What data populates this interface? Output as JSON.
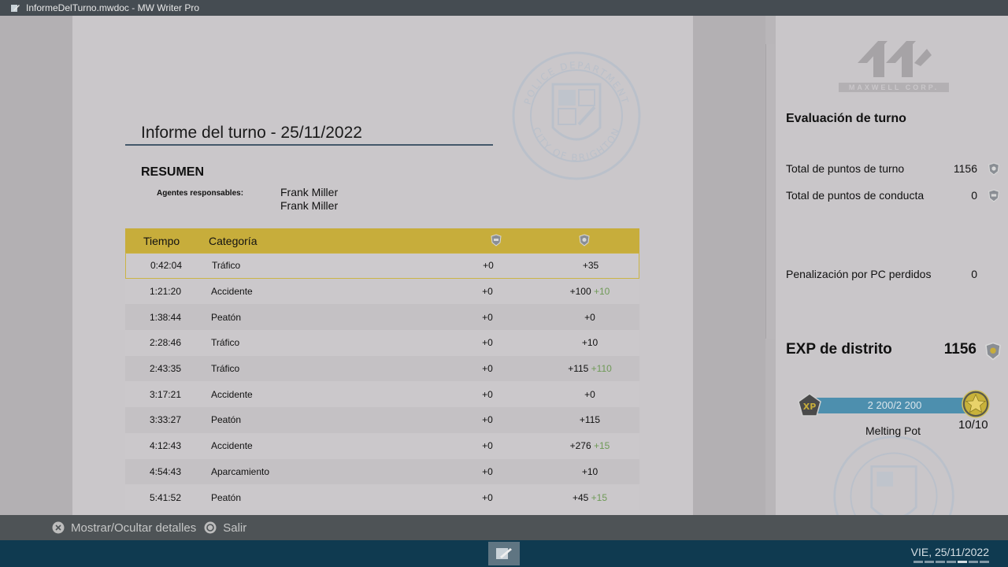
{
  "window": {
    "title": "InformeDelTurno.mwdoc - MW Writer Pro"
  },
  "document": {
    "title": "Informe del turno - 25/11/2022",
    "summary_heading": "RESUMEN",
    "agents_label": "Agentes responsables:",
    "agents": [
      "Frank Miller",
      "Frank Miller"
    ],
    "seal_top": "POLICE DEPARTMENT",
    "seal_bottom": "CITY OF BRIGHTON",
    "table": {
      "headers": {
        "time": "Tiempo",
        "category": "Categoría",
        "cp_icon": "cp-shield-icon",
        "xp_icon": "xp-shield-icon"
      },
      "rows": [
        {
          "time": "0:42:04",
          "category": "Tráfico",
          "cp": "+0",
          "xp": "+35",
          "bonus": ""
        },
        {
          "time": "1:21:20",
          "category": "Accidente",
          "cp": "+0",
          "xp": "+100",
          "bonus": "+10"
        },
        {
          "time": "1:38:44",
          "category": "Peatón",
          "cp": "+0",
          "xp": "+0",
          "bonus": ""
        },
        {
          "time": "2:28:46",
          "category": "Tráfico",
          "cp": "+0",
          "xp": "+10",
          "bonus": ""
        },
        {
          "time": "2:43:35",
          "category": "Tráfico",
          "cp": "+0",
          "xp": "+115",
          "bonus": "+110"
        },
        {
          "time": "3:17:21",
          "category": "Accidente",
          "cp": "+0",
          "xp": "+0",
          "bonus": ""
        },
        {
          "time": "3:33:27",
          "category": "Peatón",
          "cp": "+0",
          "xp": "+115",
          "bonus": ""
        },
        {
          "time": "4:12:43",
          "category": "Accidente",
          "cp": "+0",
          "xp": "+276",
          "bonus": "+15"
        },
        {
          "time": "4:54:43",
          "category": "Aparcamiento",
          "cp": "+0",
          "xp": "+10",
          "bonus": ""
        },
        {
          "time": "5:41:52",
          "category": "Peatón",
          "cp": "+0",
          "xp": "+45",
          "bonus": "+15"
        }
      ]
    }
  },
  "panel": {
    "logo_text": "MAXWELL CORP.",
    "title": "Evaluación de turno",
    "stats": [
      {
        "label": "Total de puntos de turno",
        "value": "1156"
      },
      {
        "label": "Total de puntos de conducta",
        "value": "0"
      },
      {
        "label": "Penalización por PC perdidos",
        "value": "0"
      }
    ],
    "exp_label": "EXP de distrito",
    "exp_value": "1156",
    "xp_badge": "XP",
    "xp_progress": "2 200/2 200",
    "xp_fraction": 1.0,
    "rank_name": "Melting Pot",
    "rank_level": "10/10"
  },
  "footer": {
    "toggle_details": "Mostrar/Ocultar detalles",
    "exit": "Salir"
  },
  "taskbar": {
    "clock": "VIE, 25/11/2022"
  },
  "colors": {
    "accent_gold": "#c7ad3b",
    "bonus_green": "#6f9a57",
    "xp_bar": "#4d8fae",
    "taskbar": "#0f3a50"
  }
}
